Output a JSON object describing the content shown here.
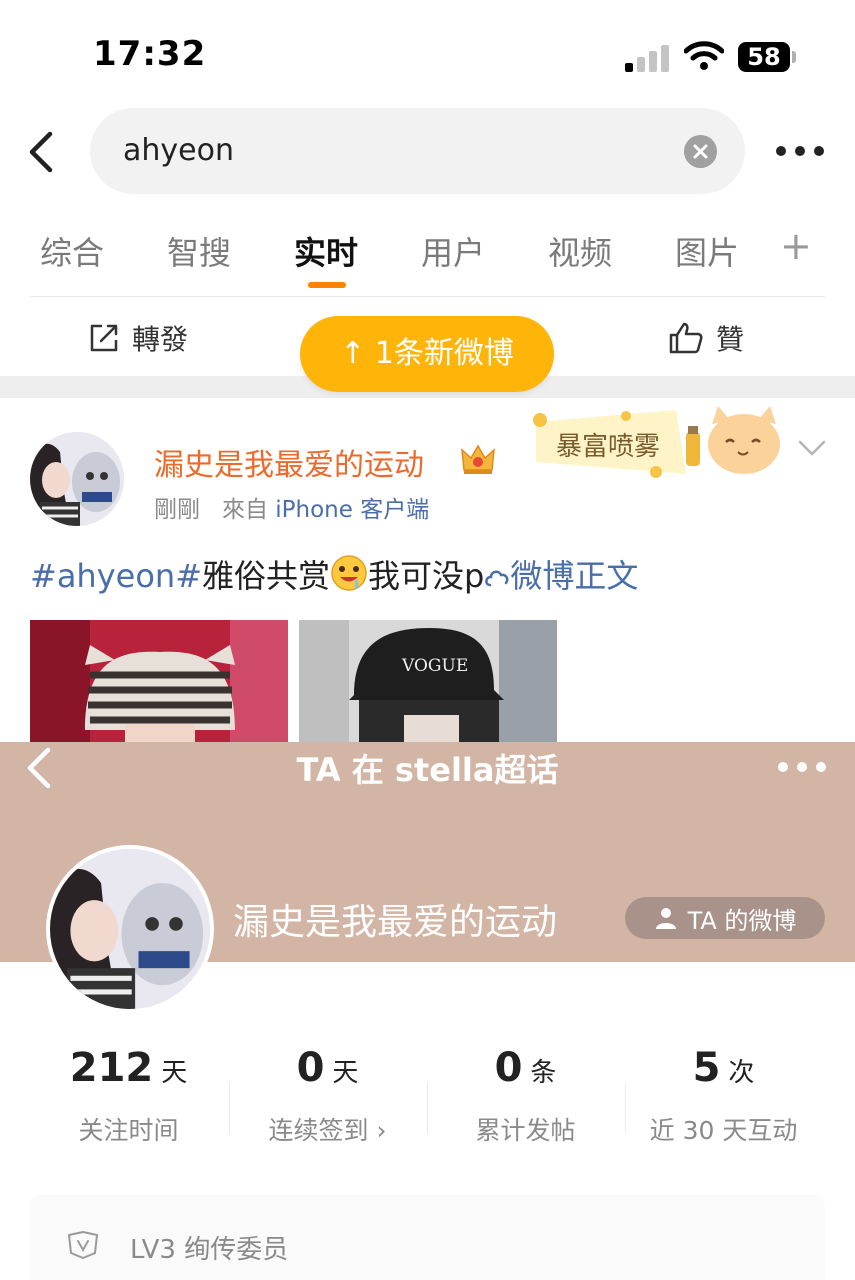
{
  "status_bar": {
    "time": "17:32",
    "battery": "58"
  },
  "search": {
    "query": "ahyeon"
  },
  "tabs": [
    {
      "label": "综合"
    },
    {
      "label": "智搜"
    },
    {
      "label": "实时"
    },
    {
      "label": "用户"
    },
    {
      "label": "视频"
    },
    {
      "label": "图片"
    }
  ],
  "active_tab": "实时",
  "actions": {
    "repost": "轉發",
    "like": "贊"
  },
  "new_posts_button": "1条新微博",
  "post": {
    "author": "漏史是我最爱的运动",
    "time": "剛剛",
    "source_prefix": "來自",
    "source": "iPhone 客户端",
    "hashtag": "#ahyeon#",
    "text_before_emoji": "雅俗共赏",
    "text_after_emoji": "我可没p",
    "link_text": "微博正文",
    "sticker_text": "暴富喷雾"
  },
  "sheet": {
    "title": "TA 在 stella超话",
    "user_name": "漏史是我最爱的运动",
    "ta_weibo_button": "TA 的微博",
    "stats": [
      {
        "value": "212",
        "unit": "天",
        "label": "关注时间"
      },
      {
        "value": "0",
        "unit": "天",
        "label": "连续签到 ›"
      },
      {
        "value": "0",
        "unit": "条",
        "label": "累计发帖"
      },
      {
        "value": "5",
        "unit": "次",
        "label": "近 30 天互动"
      }
    ],
    "level": "LV3 绚传委员"
  },
  "colors": {
    "accent": "#ff8200",
    "button_yellow": "#ffb40a",
    "link_blue": "#4a6ea9",
    "username_orange": "#ee6a2a",
    "sheet_bg": "#d2b5a5"
  }
}
